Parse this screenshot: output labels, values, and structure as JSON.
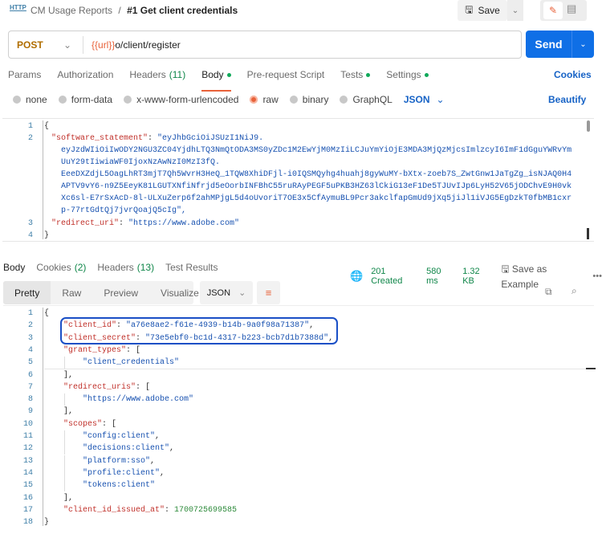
{
  "header": {
    "http_badge": "HTTP",
    "collection": "CM Usage Reports",
    "separator": "/",
    "request_name": "#1 Get client credentials",
    "save_label": "Save"
  },
  "request": {
    "method": "POST",
    "url_var": "{{url}}",
    "url_path": "o/client/register",
    "send_label": "Send"
  },
  "req_tabs": [
    {
      "label": "Params"
    },
    {
      "label": "Authorization"
    },
    {
      "label": "Headers",
      "count": "(11)"
    },
    {
      "label": "Body",
      "dot": true,
      "active": true
    },
    {
      "label": "Pre-request Script"
    },
    {
      "label": "Tests",
      "dot": true
    },
    {
      "label": "Settings",
      "dot": true
    }
  ],
  "cookies_label": "Cookies",
  "body_types": [
    "none",
    "form-data",
    "x-www-form-urlencoded",
    "raw",
    "binary",
    "GraphQL"
  ],
  "body_type_selected": "raw",
  "body_lang": "JSON",
  "beautify_label": "Beautify",
  "request_body": {
    "line_numbers": [
      "1",
      "2",
      "3",
      "4"
    ],
    "key1": "\"software_statement\"",
    "value1_lines": [
      "\"eyJhbGciOiJSUzI1NiJ9.",
      "eyJzdWIiOiIwODY2NGU3ZC04YjdhLTQ3NmQtODA3MS0yZDc1M2EwYjM0MzIiLCJuYmYiOjE3MDA3MjQzMjcsImlzcyI6ImF1dGguYWRvYm",
      "UuY29tIiwiaWF0IjoxNzAwNzI0MzI3fQ.",
      "EeeDXZdjL5OagLhRT3mjT7Qh5WvrH3HeQ_1TQW8XhiDFjl-i0IQSMQyhg4huahj8gyWuMY-bXtx-zoeb7S_ZwtGnw1JaTgZg_isNJAQ0H4",
      "APTV9vY6-n9Z5EeyK81LGUTXNfiNfrjd5eOorbINFBhC55ruRAyPEGF5uPKB3HZ63lCkiG13eF1De5TJUvIJp6LyH52V65jODChvE9H0vk",
      "Xc6sl-E7rSxAcD-8l-ULXuZerp6f2ahMPjgL5d4oUvoriT7OE3x5CfAymuBL9Pcr3akclfapGmUd9jXq5jiJl1iVJG5EgDzkT0fbMB1cxr",
      "p-77rtGdtQj7jvrQoajQ5cIg\","
    ],
    "key2": "\"redirect_uri\"",
    "value2": "\"https://www.adobe.com\"",
    "open": "{",
    "close": "}"
  },
  "response": {
    "tabs": [
      {
        "label": "Body",
        "active": true
      },
      {
        "label": "Cookies",
        "count": "(2)"
      },
      {
        "label": "Headers",
        "count": "(13)"
      },
      {
        "label": "Test Results"
      }
    ],
    "status": "201 Created",
    "time": "580 ms",
    "size": "1.32 KB",
    "save_example": "Save as Example",
    "views": [
      "Pretty",
      "Raw",
      "Preview",
      "Visualize"
    ],
    "active_view": "Pretty",
    "format": "JSON",
    "lines": [
      [
        {
          "t": "{",
          "c": "p"
        }
      ],
      [
        {
          "t": "\"client_id\"",
          "c": "k"
        },
        {
          "t": ": ",
          "c": "p"
        },
        {
          "t": "\"a76e8ae2-f61e-4939-b14b-9a0f98a71387\"",
          "c": "s"
        },
        {
          "t": ",",
          "c": "p"
        }
      ],
      [
        {
          "t": "\"client_secret\"",
          "c": "k"
        },
        {
          "t": ": ",
          "c": "p"
        },
        {
          "t": "\"73e5ebf0-bc1d-4317-b223-bcb7d1b7388d\"",
          "c": "s"
        },
        {
          "t": ",",
          "c": "p"
        }
      ],
      [
        {
          "t": "\"grant_types\"",
          "c": "k"
        },
        {
          "t": ": [",
          "c": "p"
        }
      ],
      [
        {
          "t": "\"client_credentials\"",
          "c": "s"
        }
      ],
      [
        {
          "t": "],",
          "c": "p"
        }
      ],
      [
        {
          "t": "\"redirect_uris\"",
          "c": "k"
        },
        {
          "t": ": [",
          "c": "p"
        }
      ],
      [
        {
          "t": "\"https://www.adobe.com\"",
          "c": "s",
          "link": true
        }
      ],
      [
        {
          "t": "],",
          "c": "p"
        }
      ],
      [
        {
          "t": "\"scopes\"",
          "c": "k"
        },
        {
          "t": ": [",
          "c": "p"
        }
      ],
      [
        {
          "t": "\"config:client\"",
          "c": "s"
        },
        {
          "t": ",",
          "c": "p"
        }
      ],
      [
        {
          "t": "\"decisions:client\"",
          "c": "s"
        },
        {
          "t": ",",
          "c": "p"
        }
      ],
      [
        {
          "t": "\"platform:sso\"",
          "c": "s"
        },
        {
          "t": ",",
          "c": "p"
        }
      ],
      [
        {
          "t": "\"profile:client\"",
          "c": "s"
        },
        {
          "t": ",",
          "c": "p"
        }
      ],
      [
        {
          "t": "\"tokens:client\"",
          "c": "s"
        }
      ],
      [
        {
          "t": "],",
          "c": "p"
        }
      ],
      [
        {
          "t": "\"client_id_issued_at\"",
          "c": "k"
        },
        {
          "t": ": ",
          "c": "p"
        },
        {
          "t": "1700725699585",
          "c": "n"
        }
      ],
      [
        {
          "t": "}",
          "c": "p"
        }
      ]
    ],
    "indent": [
      0,
      1,
      1,
      1,
      2,
      1,
      1,
      2,
      1,
      1,
      2,
      2,
      2,
      2,
      2,
      1,
      1,
      0
    ]
  },
  "colors": {
    "accent": "#e8623a",
    "primary": "#0f6fe6",
    "success": "#10874a",
    "highlight": "#1a4fc6"
  }
}
